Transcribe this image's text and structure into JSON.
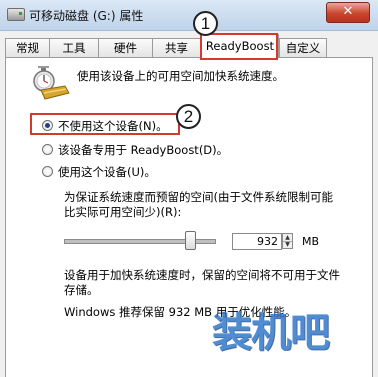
{
  "window": {
    "title": "可移动磁盘 (G:) 属性",
    "close_glyph": "✕"
  },
  "tabs": [
    {
      "label": "常规",
      "active": false
    },
    {
      "label": "工具",
      "active": false
    },
    {
      "label": "硬件",
      "active": false
    },
    {
      "label": "共享",
      "active": false
    },
    {
      "label": "ReadyBoost",
      "active": true
    },
    {
      "label": "自定义",
      "active": false
    }
  ],
  "callouts": [
    "1",
    "2"
  ],
  "readyboost": {
    "icon": "readyboost-stopwatch-icon",
    "description": "使用该设备上的可用空间加快系统速度。",
    "options": [
      {
        "label": "不使用这个设备(N)。",
        "checked": true
      },
      {
        "label": "该设备专用于 ReadyBoost(D)。",
        "checked": false
      },
      {
        "label": "使用这个设备(U)。",
        "checked": false
      }
    ],
    "reserve_label_line1": "为保证系统速度而预留的空间(由于文件系统限制可能",
    "reserve_label_line2": "比实际可用空间少)(R):",
    "reserve_value": "932",
    "reserve_unit": "MB",
    "slider_fraction": 0.83,
    "note_line1": "设备用于加快系统速度时，保留的空间将不可用于文件",
    "note_line2": "存储。",
    "recommend": "Windows 推荐保留 932 MB 用于优化性能。"
  },
  "watermark": "装机吧",
  "colors": {
    "highlight": "#d43a2c",
    "watermark": "#2a73c8"
  }
}
